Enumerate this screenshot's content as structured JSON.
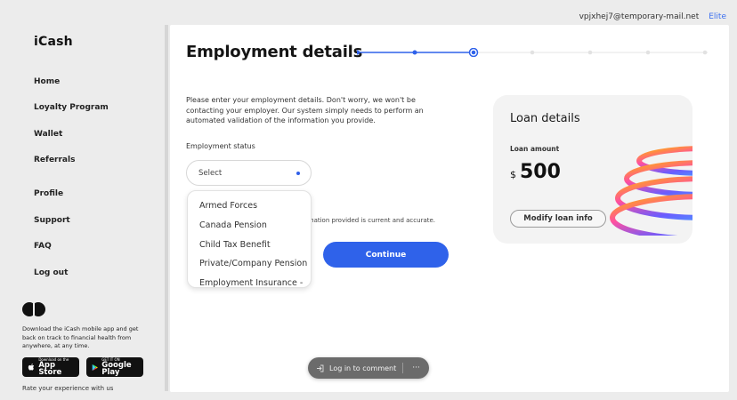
{
  "header": {
    "email": "vpjxhej7@temporary-mail.net",
    "tier": "Elite"
  },
  "sidebar": {
    "logo": "iCash",
    "nav_primary": [
      "Home",
      "Loyalty Program",
      "Wallet",
      "Referrals"
    ],
    "nav_secondary": [
      "Profile",
      "Support",
      "FAQ",
      "Log out"
    ],
    "promo_text": "Download the iCash mobile app and get back on track to financial health from anywhere, at any time.",
    "app_store": {
      "small": "Download on the",
      "big": "App Store"
    },
    "google_play": {
      "small": "GET IT ON",
      "big": "Google Play"
    },
    "rate_text": "Rate your experience with us"
  },
  "main": {
    "title": "Employment details",
    "stepper": {
      "total_steps": 7,
      "current_step": 3
    },
    "intro": "Please enter your employment details. Don't worry, we won't be contacting your employer. Our system simply needs to perform an automated validation of the information you provide.",
    "status_label": "Employment status",
    "select_placeholder": "Select",
    "dropdown_options": [
      "Armed Forces",
      "Canada Pension",
      "Child Tax Benefit",
      "Private/Company Pension",
      "Employment Insurance -"
    ],
    "confirm_text": "rmation provided is current and accurate.",
    "continue_label": "Continue"
  },
  "loan": {
    "title": "Loan details",
    "amount_label": "Loan amount",
    "currency": "$",
    "amount": "500",
    "modify_label": "Modify loan info"
  },
  "comment_bar": {
    "login_label": "Log in to comment",
    "more_label": "···"
  },
  "colors": {
    "accent": "#2f62ea",
    "background": "#ececec",
    "card": "#f3f3f3"
  },
  "icons": [
    "login-arrow-icon",
    "apple-icon",
    "google-play-icon",
    "more-icon",
    "select-indicator-icon"
  ]
}
